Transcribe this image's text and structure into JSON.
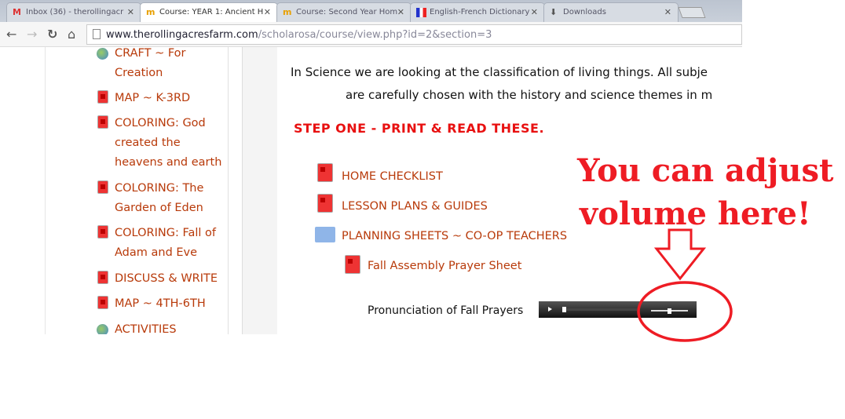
{
  "browser": {
    "tabs": [
      {
        "label": "Inbox (36) - therollingacr",
        "icon": "gmail-icon",
        "active": false
      },
      {
        "label": "Course: YEAR 1: Ancient H",
        "icon": "moodle-icon",
        "active": true
      },
      {
        "label": "Course: Second Year Hom",
        "icon": "moodle-icon",
        "active": false
      },
      {
        "label": "English-French Dictionary",
        "icon": "flag-icon",
        "active": false
      },
      {
        "label": "Downloads",
        "icon": "download-icon",
        "active": false
      }
    ],
    "url_host": "www.therollingacresfarm.com",
    "url_path": "/scholarosa/course/view.php?id=2&section=3"
  },
  "sidebar": {
    "items": [
      {
        "label": "CRAFT ~ For Creation",
        "icon": "globe-icon"
      },
      {
        "label": "MAP ~ K-3RD",
        "icon": "pdf-icon"
      },
      {
        "label": "COLORING: God created the heavens and earth",
        "icon": "pdf-icon"
      },
      {
        "label": "COLORING: The Garden of Eden",
        "icon": "pdf-icon"
      },
      {
        "label": "COLORING: Fall of Adam and Eve",
        "icon": "pdf-icon"
      },
      {
        "label": "DISCUSS & WRITE",
        "icon": "pdf-icon"
      },
      {
        "label": "MAP ~ 4TH-6TH",
        "icon": "pdf-icon"
      },
      {
        "label": "ACTIVITIES",
        "icon": "globe-icon"
      }
    ]
  },
  "main": {
    "intro_line1": "In Science we are looking at the classification of living things. All subje",
    "intro_line2": "are carefully chosen with the history and science themes in m",
    "step_heading": "STEP ONE - PRINT & READ THESE.",
    "resources": [
      {
        "label": "HOME CHECKLIST",
        "icon": "pdf-icon"
      },
      {
        "label": "LESSON PLANS & GUIDES",
        "icon": "pdf-icon"
      },
      {
        "label": "PLANNING SHEETS ~ CO-OP TEACHERS",
        "icon": "folder-icon"
      },
      {
        "label": "Fall Assembly Prayer Sheet",
        "icon": "pdf-icon"
      }
    ],
    "audio_label": "Pronunciation of Fall Prayers",
    "audio": {
      "progress": 0.0,
      "volume": 0.5
    }
  },
  "annotation": {
    "text_line1": "You can adjust",
    "text_line2": "volume here!",
    "color": "#ee1c24"
  }
}
